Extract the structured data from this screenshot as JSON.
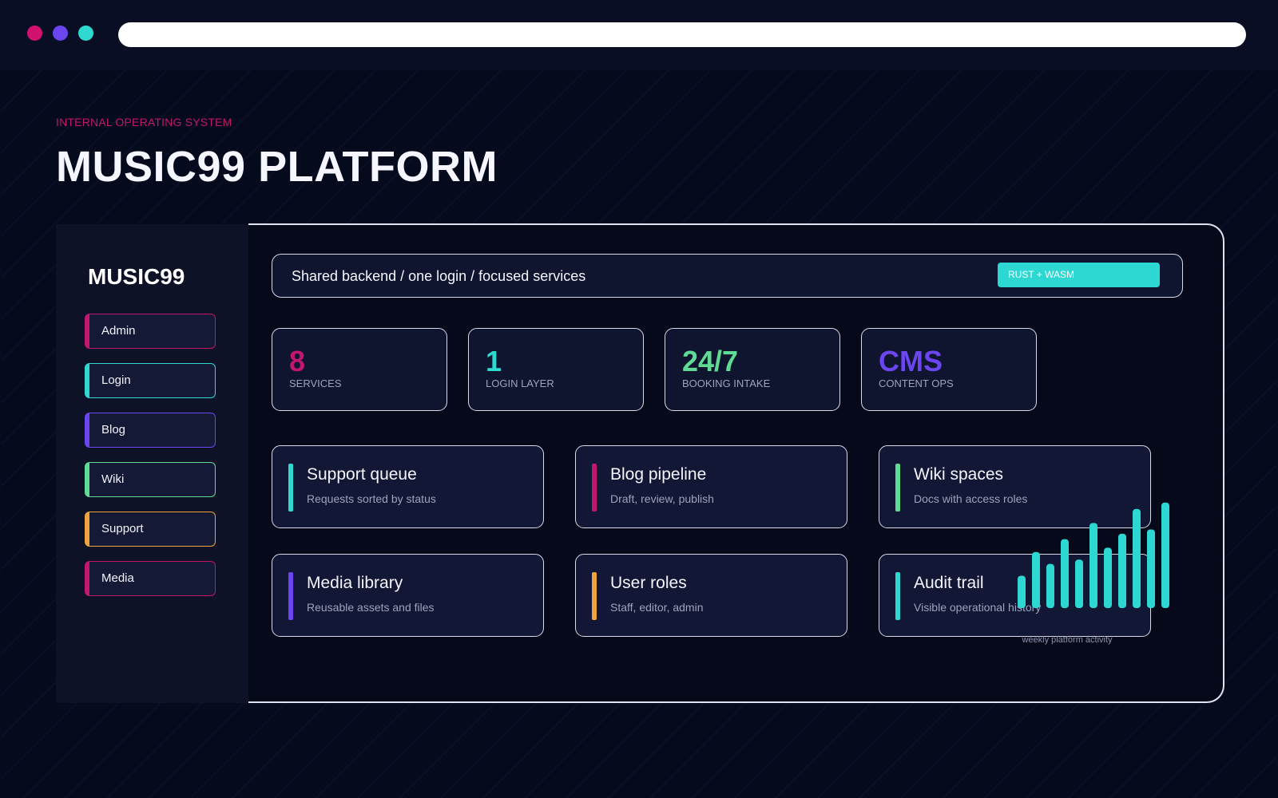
{
  "window": {
    "controls": [
      "close-dot",
      "minimize-dot",
      "zoom-dot"
    ]
  },
  "header": {
    "eyebrow": "INTERNAL OPERATING SYSTEM",
    "title": "MUSIC99 PLATFORM"
  },
  "sidebar": {
    "brand": "MUSIC99",
    "items": [
      {
        "label": "Admin",
        "color": "#c2166f"
      },
      {
        "label": "Login",
        "color": "#2fd9d0"
      },
      {
        "label": "Blog",
        "color": "#6a45f0"
      },
      {
        "label": "Wiki",
        "color": "#5fdb93"
      },
      {
        "label": "Support",
        "color": "#f0a33c"
      },
      {
        "label": "Media",
        "color": "#c2166f"
      }
    ]
  },
  "main": {
    "tagline": "Shared backend / one login / focused services",
    "tech_chip": "RUST + WASM",
    "stats": [
      {
        "value": "8",
        "label": "SERVICES",
        "color": "#c2166f"
      },
      {
        "value": "1",
        "label": "LOGIN LAYER",
        "color": "#2fd9d0"
      },
      {
        "value": "24/7",
        "label": "BOOKING INTAKE",
        "color": "#5fdb93"
      },
      {
        "value": "CMS",
        "label": "CONTENT OPS",
        "color": "#6a45f0"
      }
    ],
    "services": [
      {
        "title": "Support queue",
        "desc": "Requests sorted by status",
        "accent": "#2fd9d0"
      },
      {
        "title": "Blog pipeline",
        "desc": "Draft, review, publish",
        "accent": "#c2166f"
      },
      {
        "title": "Wiki spaces",
        "desc": "Docs with access roles",
        "accent": "#5fdb93"
      },
      {
        "title": "Media library",
        "desc": "Reusable assets and files",
        "accent": "#6a45f0"
      },
      {
        "title": "User roles",
        "desc": "Staff, editor, admin",
        "accent": "#f0a33c"
      },
      {
        "title": "Audit trail",
        "desc": "Visible operational history",
        "accent": "#2fd9d0"
      }
    ]
  },
  "chart_data": {
    "type": "bar",
    "title": "",
    "caption": "weekly platform activity",
    "values": [
      3,
      5.2,
      4.1,
      6.4,
      4.5,
      7.9,
      5.6,
      6.9,
      9.2,
      7.3,
      9.8
    ],
    "ylim": [
      0,
      10
    ],
    "color": "#2ed8d2",
    "grid": false
  }
}
